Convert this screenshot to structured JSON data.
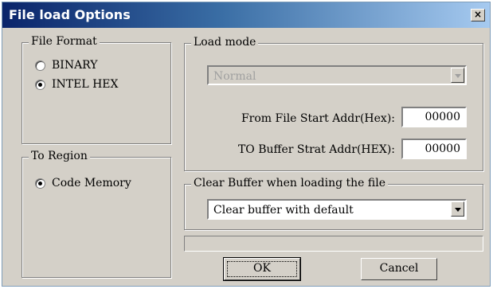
{
  "window": {
    "title": "File load Options",
    "close_symbol": "×"
  },
  "file_format": {
    "legend": "File Format",
    "options": [
      {
        "label": "BINARY",
        "checked": false
      },
      {
        "label": "INTEL HEX",
        "checked": true
      }
    ]
  },
  "to_region": {
    "legend": "To Region",
    "options": [
      {
        "label": "Code Memory",
        "checked": true
      }
    ]
  },
  "load_mode": {
    "legend": "Load mode",
    "mode_value": "Normal",
    "mode_disabled": true,
    "start_addr_label": "From File Start Addr(Hex):",
    "start_addr_value": "00000",
    "buffer_addr_label": "TO Buffer Strat Addr(HEX):",
    "buffer_addr_value": "00000"
  },
  "clear_buffer": {
    "legend": "Clear Buffer when loading the file",
    "selected": "Clear buffer with default"
  },
  "buttons": {
    "ok": "OK",
    "cancel": "Cancel"
  },
  "colors": {
    "title_bar_start": "#0a246a",
    "title_bar_end": "#a6caf0",
    "dialog_face": "#d4d0c8"
  }
}
